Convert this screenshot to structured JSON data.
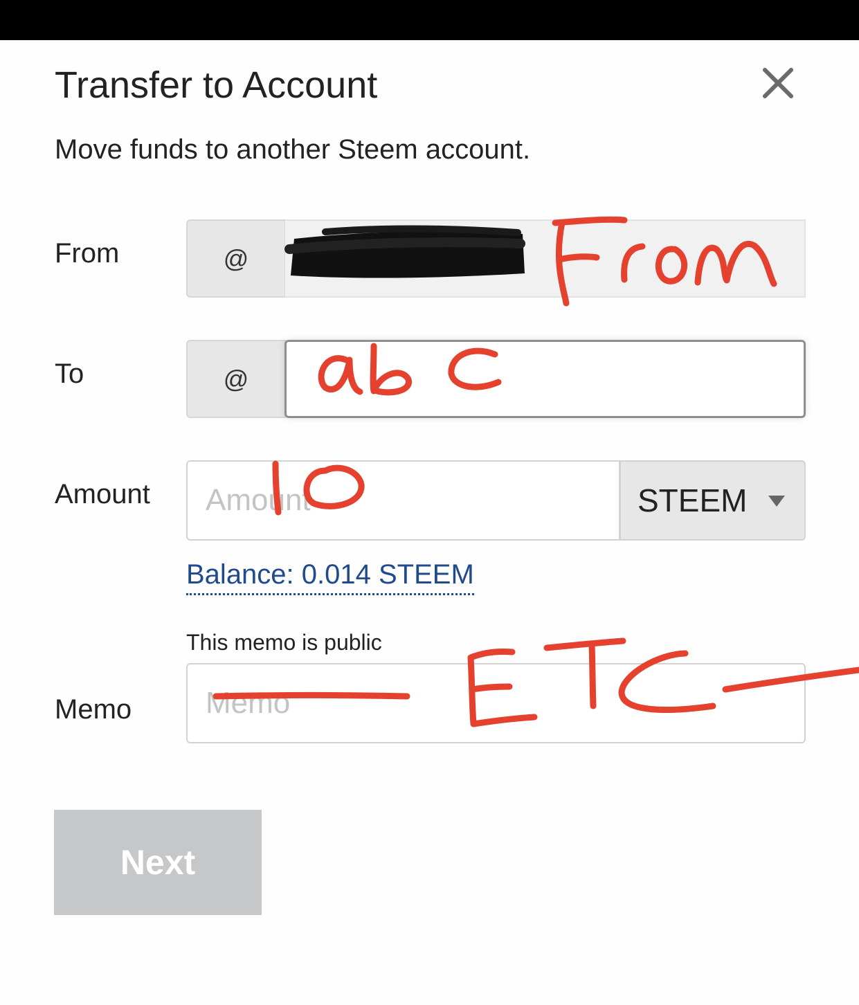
{
  "dialog": {
    "title": "Transfer to Account",
    "subtitle": "Move funds to another Steem account.",
    "close_icon": "close-icon"
  },
  "form": {
    "from": {
      "label": "From",
      "prefix": "@",
      "value": "",
      "value_redacted": true
    },
    "to": {
      "label": "To",
      "prefix": "@",
      "value": ""
    },
    "amount": {
      "label": "Amount",
      "placeholder": "Amount",
      "value": "",
      "asset": "STEEM",
      "asset_icon": "chevron-down-icon"
    },
    "balance_text": "Balance: 0.014 STEEM",
    "memo": {
      "label": "Memo",
      "note": "This memo is public",
      "placeholder": "Memo",
      "value": ""
    }
  },
  "actions": {
    "next_label": "Next"
  },
  "handwritten_annotations": [
    "From",
    "abc",
    "10",
    "ETC"
  ],
  "colors": {
    "top_bar": "#000000",
    "link": "#1f4a8e",
    "disabled_button": "#c6c7c9",
    "annotation_ink": "#e5412f"
  }
}
